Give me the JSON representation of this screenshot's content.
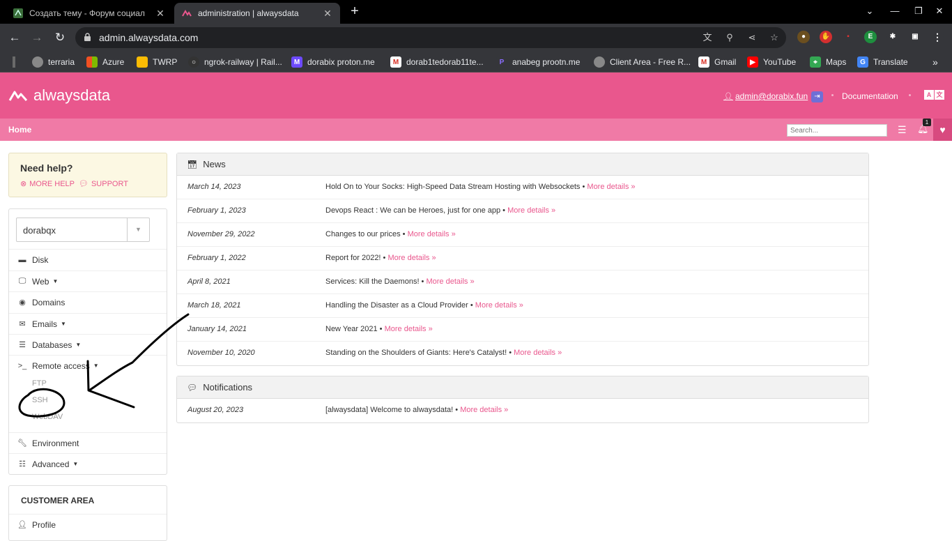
{
  "browser": {
    "tabs": [
      {
        "title": "Создать тему - Форум социал"
      },
      {
        "title": "administration | alwaysdata"
      }
    ],
    "url": "admin.alwaysdata.com",
    "bookmarks": [
      {
        "label": "terraria",
        "color": "#888888"
      },
      {
        "label": "Azure",
        "color": "#0078d4"
      },
      {
        "label": "TWRP",
        "color": "#1e88e5"
      },
      {
        "label": "ngrok-railway | Rail...",
        "color": "#333333"
      },
      {
        "label": "dorabix proton.me",
        "color": "#6d4aff"
      },
      {
        "label": "dorab1tedorab11te...",
        "color": "#d93025"
      },
      {
        "label": "anabeg prootn.me",
        "color": "#6d4aff"
      },
      {
        "label": "Client Area - Free R...",
        "color": "#888888"
      },
      {
        "label": "Gmail",
        "color": "#d93025"
      },
      {
        "label": "YouTube",
        "color": "#ff0000"
      },
      {
        "label": "Maps",
        "color": "#34a853"
      },
      {
        "label": "Translate",
        "color": "#4285f4"
      }
    ]
  },
  "header": {
    "brand": "alwaysdata",
    "user": "admin@dorabix.fun",
    "documentation": "Documentation",
    "accent": "#e9578d"
  },
  "subnav": {
    "home": "Home",
    "search_placeholder": "Search...",
    "notification_count": "1"
  },
  "help": {
    "title": "Need help?",
    "more_help": "MORE HELP",
    "support": "SUPPORT"
  },
  "sidebar": {
    "account": "dorabqx",
    "items": [
      {
        "label": "Disk",
        "icon": "disk-icon"
      },
      {
        "label": "Web",
        "icon": "monitor-icon"
      },
      {
        "label": "Domains",
        "icon": "globe-icon"
      },
      {
        "label": "Emails",
        "icon": "envelope-icon"
      },
      {
        "label": "Databases",
        "icon": "database-icon"
      },
      {
        "label": "Remote access",
        "icon": "terminal-icon"
      }
    ],
    "remote_sub": [
      "FTP",
      "SSH",
      "WebDAV"
    ],
    "items_after": [
      {
        "label": "Environment",
        "icon": "wrench-icon"
      },
      {
        "label": "Advanced",
        "icon": "server-icon"
      }
    ],
    "customer_area": "CUSTOMER AREA",
    "profile": "Profile"
  },
  "news": {
    "title": "News",
    "more": "More details »",
    "rows": [
      {
        "date": "March 14, 2023",
        "text": "Hold On to Your Socks: High-Speed Data Stream Hosting with Websockets"
      },
      {
        "date": "February 1, 2023",
        "text": "Devops React : We can be Heroes, just for one app"
      },
      {
        "date": "November 29, 2022",
        "text": "Changes to our prices"
      },
      {
        "date": "February 1, 2022",
        "text": "Report for 2022!"
      },
      {
        "date": "April 8, 2021",
        "text": "Services: Kill the Daemons!"
      },
      {
        "date": "March 18, 2021",
        "text": "Handling the Disaster as a Cloud Provider"
      },
      {
        "date": "January 14, 2021",
        "text": "New Year 2021"
      },
      {
        "date": "November 10, 2020",
        "text": "Standing on the Shoulders of Giants: Here's Catalyst!"
      }
    ]
  },
  "notifications": {
    "title": "Notifications",
    "rows": [
      {
        "date": "August 20, 2023",
        "text": "[alwaysdata] Welcome to alwaysdata!"
      }
    ]
  }
}
